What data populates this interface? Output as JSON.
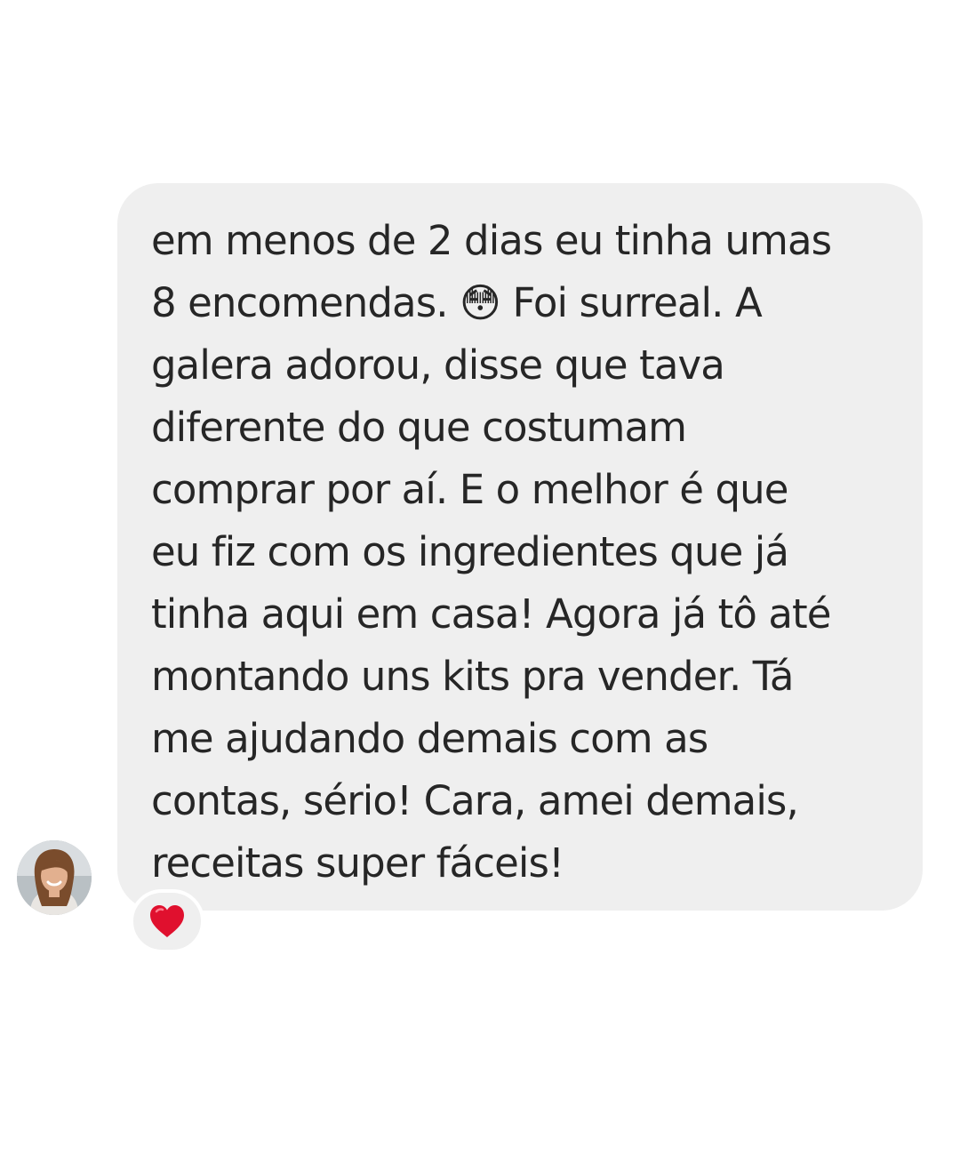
{
  "message": {
    "text_lines": [
      "em menos de 2 dias eu tinha umas",
      "8 encomendas. 😳 Foi surreal. A",
      "galera adorou, disse que tava",
      "diferente do que costumam",
      "comprar por aí. E o melhor é que",
      "eu fiz com os ingredientes que já",
      "tinha aqui em casa! Agora já tô até",
      "montando uns kits pra vender. Tá",
      "me ajudando demais com as",
      "contas, sério! Cara, amei demais,",
      "receitas super fáceis!"
    ]
  },
  "sender": {
    "avatar_icon": "profile-photo"
  },
  "reaction": {
    "icon": "red-heart-icon",
    "color": "#e0102e"
  },
  "colors": {
    "bubble": "#efefef",
    "text": "#262626"
  }
}
